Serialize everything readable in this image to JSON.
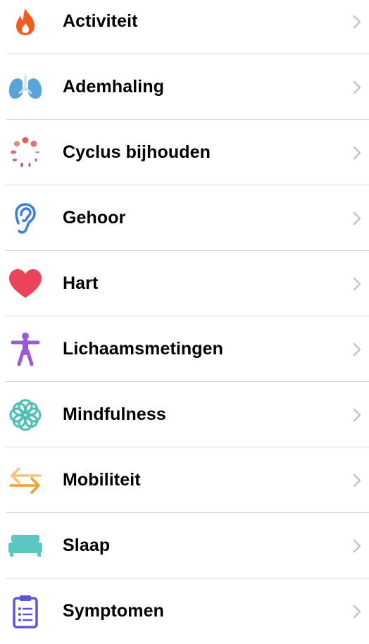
{
  "categories": [
    {
      "label": "Activiteit",
      "icon": "flame-icon",
      "color": "#fa5a1e"
    },
    {
      "label": "Ademhaling",
      "icon": "lungs-icon",
      "color": "#5aa3d9"
    },
    {
      "label": "Cyclus bijhouden",
      "icon": "cycle-tracking-icon",
      "color": "#e0605a"
    },
    {
      "label": "Gehoor",
      "icon": "ear-icon",
      "color": "#3b7de0"
    },
    {
      "label": "Hart",
      "icon": "heart-icon",
      "color": "#eb445a"
    },
    {
      "label": "Lichaamsmetingen",
      "icon": "body-figure-icon",
      "color": "#9b59d8"
    },
    {
      "label": "Mindfulness",
      "icon": "mindfulness-flower-icon",
      "color": "#4fbfb4"
    },
    {
      "label": "Mobiliteit",
      "icon": "mobility-arrows-icon",
      "color": "#f0a030"
    },
    {
      "label": "Slaap",
      "icon": "bed-icon",
      "color": "#5ac8c0"
    },
    {
      "label": "Symptomen",
      "icon": "clipboard-list-icon",
      "color": "#5b57d6"
    }
  ],
  "chevron_icon": "chevron-right-icon",
  "chevron_color": "#c4c4c7"
}
